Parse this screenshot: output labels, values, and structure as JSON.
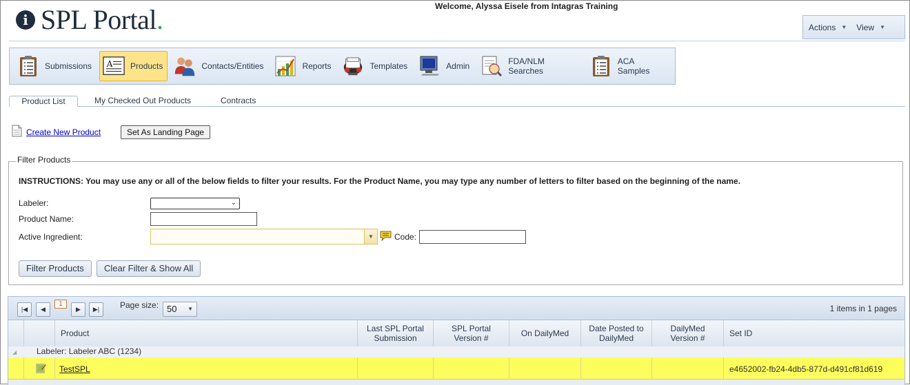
{
  "header": {
    "logo_text": "SPL Portal",
    "logo_dot": ".",
    "logo_badge": "i",
    "welcome": "Welcome, Alyssa Eisele from Intagras Training",
    "actions_label": "Actions",
    "view_label": "View"
  },
  "nav": {
    "active": "Products",
    "items": [
      {
        "label": "Submissions",
        "icon": "clipboard-list-icon"
      },
      {
        "label": "Products",
        "icon": "document-a-icon"
      },
      {
        "label": "Contacts/Entities",
        "icon": "people-icon"
      },
      {
        "label": "Reports",
        "icon": "chart-icon"
      },
      {
        "label": "Templates",
        "icon": "rolodex-icon"
      },
      {
        "label": "Admin",
        "icon": "monitor-icon"
      },
      {
        "label": "FDA/NLM Searches",
        "icon": "document-search-icon"
      },
      {
        "label": "ACA Samples",
        "icon": "clipboard-list-icon"
      }
    ]
  },
  "tabs": {
    "items": [
      {
        "label": "Product List",
        "active": true
      },
      {
        "label": "My Checked Out Products",
        "active": false
      },
      {
        "label": "Contracts",
        "active": false
      }
    ]
  },
  "toolbar": {
    "create_link": "Create New Product",
    "landing_button": "Set As Landing Page"
  },
  "filter": {
    "legend": "Filter Products",
    "instructions": "INSTRUCTIONS: You may use any or all of the below fields to filter your results. For the Product Name, you may type any number of letters to filter based on the beginning of the name.",
    "labeler_label": "Labeler:",
    "labeler_value": "",
    "product_name_label": "Product Name:",
    "product_name_value": "",
    "active_ingredient_label": "Active Ingredient:",
    "active_ingredient_value": "",
    "code_label": "Code:",
    "code_value": "",
    "filter_button": "Filter Products",
    "clear_button": "Clear Filter & Show All"
  },
  "grid": {
    "current_page": "1",
    "page_size_label": "Page size:",
    "page_size": "50",
    "items_info": "1 items in 1 pages",
    "columns": {
      "product": "Product",
      "last_submission": "Last SPL Portal\nSubmission",
      "spl_version": "SPL Portal\nVersion #",
      "on_dailymed": "On DailyMed",
      "date_posted": "Date Posted to\nDailyMed",
      "dailymed_version": "DailyMed\nVersion #",
      "set_id": "Set ID"
    },
    "group_label": "Labeler: Labeler ABC (1234)",
    "rows": [
      {
        "product": "TestSPL",
        "last_submission": "",
        "spl_version": "",
        "on_dailymed": "",
        "date_posted": "",
        "dailymed_version": "",
        "set_id": "e4652002-fb24-4db5-877d-d491cf81d619"
      }
    ]
  },
  "colors": {
    "accent_blue": "#a9bdd6",
    "active_nav": "#fde38a",
    "highlight_row": "#fdfd5e",
    "logo_dark": "#1f2d3d",
    "logo_dot_green": "#2fa84f"
  }
}
